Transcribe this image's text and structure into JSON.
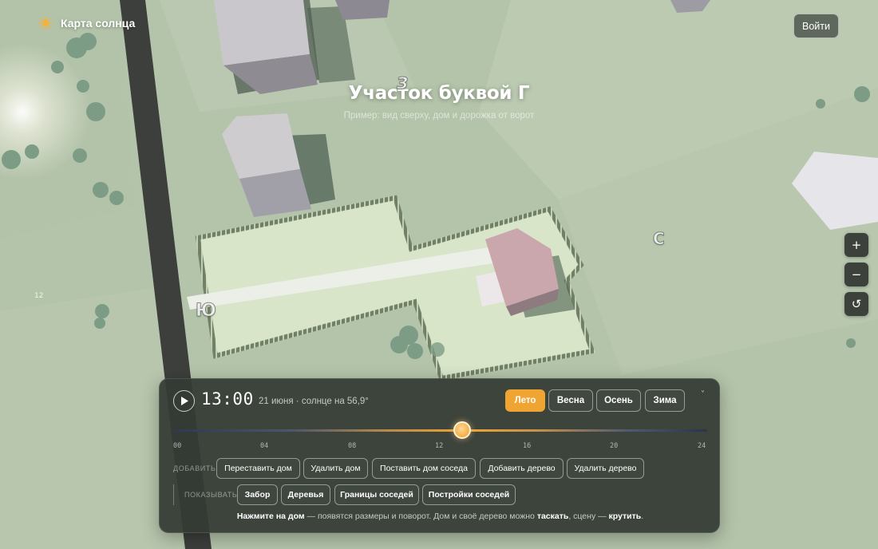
{
  "app": {
    "title": "Карта солнца",
    "logo_icon": "sun-icon",
    "login_label": "Войти"
  },
  "page": {
    "title": "Участок буквой Г",
    "subtitle": "Пример: вид сверху, дом и дорожка от ворот"
  },
  "compass": {
    "north": "З",
    "east": "С",
    "south": "Ю"
  },
  "corner_number": "12",
  "map_controls": {
    "zoom_in": "+",
    "zoom_out": "−",
    "reset": "↺"
  },
  "panel": {
    "time": "13:00",
    "date_info": "21 июня · солнце на 56,9°",
    "seasons": [
      "Лето",
      "Весна",
      "Осень",
      "Зима"
    ],
    "active_season": "Лето",
    "collapse": "˅",
    "time_progress": 0.5417,
    "ticks": [
      "00",
      "04",
      "08",
      "12",
      "16",
      "20",
      "24"
    ],
    "add_label": "ДОБАВИТЬ",
    "add_actions": [
      "Переставить дом",
      "Удалить дом",
      "Поставить дом соседа",
      "Добавить дерево",
      "Удалить дерево"
    ],
    "show_label": "ПОКАЗЫВАТЬ",
    "show_toggles": [
      "Забор",
      "Деревья",
      "Границы соседей",
      "Постройки соседей"
    ],
    "hint": {
      "p1": "Нажмите на дом",
      "p2": " — появятся размеры и поворот. Дом и своё дерево можно ",
      "p3": "таскать",
      "p4": ", сцену — ",
      "p5": "крутить",
      "p6": "."
    }
  },
  "colors": {
    "accent": "#f0a532",
    "panel_bg": "#343a34",
    "ground": "#b7c6ad",
    "lot": "#d5e2c6",
    "road": "#3b3d3a"
  }
}
